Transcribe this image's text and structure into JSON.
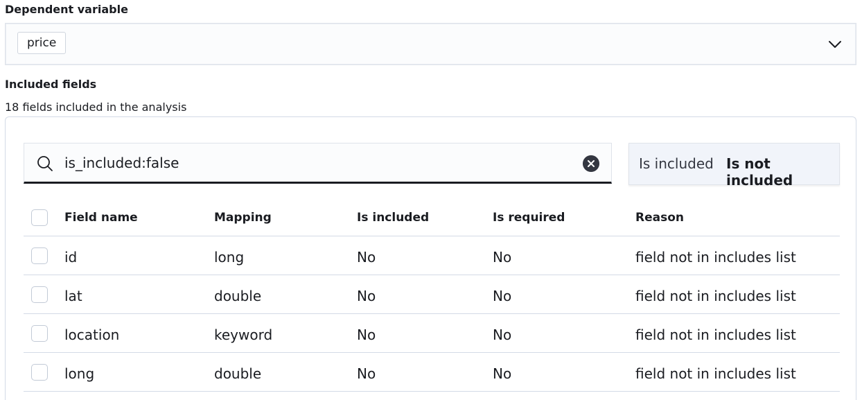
{
  "dependent_variable": {
    "label": "Dependent variable",
    "selected": "price"
  },
  "included_fields": {
    "title": "Included fields",
    "summary": "18 fields included in the analysis"
  },
  "search": {
    "query": "is_included:false"
  },
  "filter_toggle": {
    "included_label": "Is included",
    "not_included_label": "Is not included",
    "active": "Is not included"
  },
  "table": {
    "columns": [
      "Field name",
      "Mapping",
      "Is included",
      "Is required",
      "Reason"
    ],
    "rows": [
      [
        "id",
        "long",
        "No",
        "No",
        "field not in includes list"
      ],
      [
        "lat",
        "double",
        "No",
        "No",
        "field not in includes list"
      ],
      [
        "location",
        "keyword",
        "No",
        "No",
        "field not in includes list"
      ],
      [
        "long",
        "double",
        "No",
        "No",
        "field not in includes list"
      ]
    ]
  },
  "colors": {
    "text": "#1a1c21",
    "border": "#d3dae6",
    "input_bg": "#fbfcfd",
    "toggle_bg": "#f1f4fa"
  }
}
